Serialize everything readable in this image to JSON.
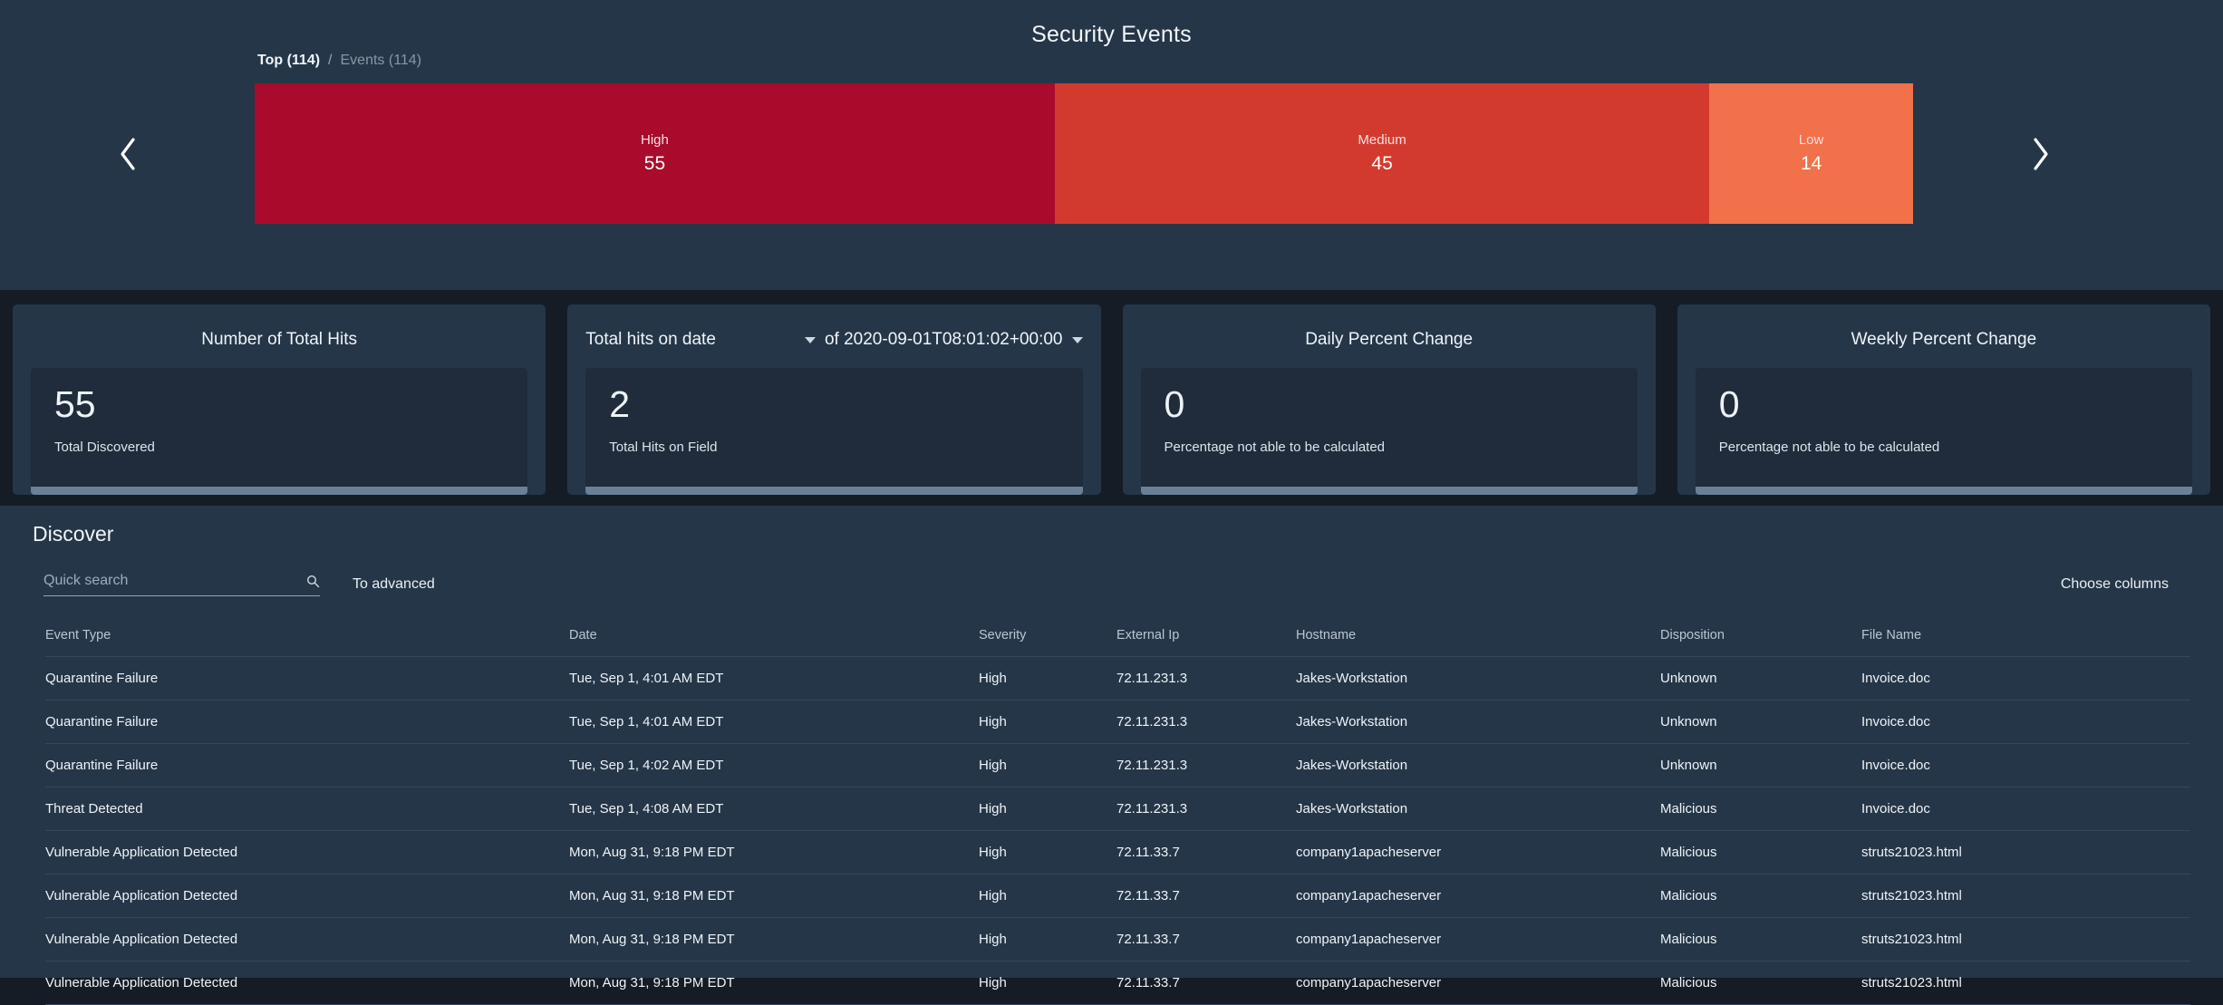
{
  "header": {
    "title": "Security Events"
  },
  "breadcrumb": {
    "active": "Top (114)",
    "separator": "/",
    "muted": "Events (114)"
  },
  "nav": {
    "prev_icon": "chevron-left-icon",
    "next_icon": "chevron-right-icon"
  },
  "severity_chart": {
    "type": "bar",
    "title": "Security Events severity distribution",
    "orientation": "horizontal-stacked",
    "total": 114,
    "categories": [
      "High",
      "Medium",
      "Low"
    ],
    "values": [
      55,
      45,
      14
    ],
    "colors": [
      "#a80b2c",
      "#d33a2e",
      "#f0714a"
    ],
    "segments": [
      {
        "label": "High",
        "value": 55,
        "color": "#a80b2c"
      },
      {
        "label": "Medium",
        "value": 45,
        "color": "#d33a2e"
      },
      {
        "label": "Low",
        "value": 14,
        "color": "#f0714a"
      }
    ]
  },
  "cards": [
    {
      "title": "Number of Total Hits",
      "value": "55",
      "subtitle": "Total Discovered",
      "has_dropdowns": false
    },
    {
      "title": "Total hits on date",
      "field_caret": "chevron-down-icon",
      "of_label": "of 2020-09-01T08:01:02+00:00",
      "date_caret": "chevron-down-icon",
      "value": "2",
      "subtitle": "Total Hits on Field",
      "has_dropdowns": true
    },
    {
      "title": "Daily Percent Change",
      "value": "0",
      "subtitle": "Percentage not able to be calculated",
      "has_dropdowns": false
    },
    {
      "title": "Weekly Percent Change",
      "value": "0",
      "subtitle": "Percentage not able to be calculated",
      "has_dropdowns": false
    }
  ],
  "discover": {
    "title": "Discover",
    "search_placeholder": "Quick search",
    "search_value": "",
    "search_icon": "search-icon",
    "to_advanced": "To advanced",
    "choose_columns": "Choose columns",
    "columns": [
      "Event Type",
      "Date",
      "Severity",
      "External Ip",
      "Hostname",
      "Disposition",
      "File Name"
    ],
    "rows": [
      {
        "event_type": "Quarantine Failure",
        "date": "Tue, Sep 1, 4:01 AM EDT",
        "severity": "High",
        "external_ip": "72.11.231.3",
        "hostname": "Jakes-Workstation",
        "disposition": "Unknown",
        "file_name": "Invoice.doc"
      },
      {
        "event_type": "Quarantine Failure",
        "date": "Tue, Sep 1, 4:01 AM EDT",
        "severity": "High",
        "external_ip": "72.11.231.3",
        "hostname": "Jakes-Workstation",
        "disposition": "Unknown",
        "file_name": "Invoice.doc"
      },
      {
        "event_type": "Quarantine Failure",
        "date": "Tue, Sep 1, 4:02 AM EDT",
        "severity": "High",
        "external_ip": "72.11.231.3",
        "hostname": "Jakes-Workstation",
        "disposition": "Unknown",
        "file_name": "Invoice.doc"
      },
      {
        "event_type": "Threat Detected",
        "date": "Tue, Sep 1, 4:08 AM EDT",
        "severity": "High",
        "external_ip": "72.11.231.3",
        "hostname": "Jakes-Workstation",
        "disposition": "Malicious",
        "file_name": "Invoice.doc"
      },
      {
        "event_type": "Vulnerable Application Detected",
        "date": "Mon, Aug 31, 9:18 PM EDT",
        "severity": "High",
        "external_ip": "72.11.33.7",
        "hostname": "company1apacheserver",
        "disposition": "Malicious",
        "file_name": "struts21023.html"
      },
      {
        "event_type": "Vulnerable Application Detected",
        "date": "Mon, Aug 31, 9:18 PM EDT",
        "severity": "High",
        "external_ip": "72.11.33.7",
        "hostname": "company1apacheserver",
        "disposition": "Malicious",
        "file_name": "struts21023.html"
      },
      {
        "event_type": "Vulnerable Application Detected",
        "date": "Mon, Aug 31, 9:18 PM EDT",
        "severity": "High",
        "external_ip": "72.11.33.7",
        "hostname": "company1apacheserver",
        "disposition": "Malicious",
        "file_name": "struts21023.html"
      },
      {
        "event_type": "Vulnerable Application Detected",
        "date": "Mon, Aug 31, 9:18 PM EDT",
        "severity": "High",
        "external_ip": "72.11.33.7",
        "hostname": "company1apacheserver",
        "disposition": "Malicious",
        "file_name": "struts21023.html"
      }
    ]
  },
  "colors": {
    "page_bg": "#151c26",
    "panel_bg": "#253648",
    "card_body_bg": "#202b3b",
    "accent_bar": "#6a8097",
    "severity_high": "#a80b2c",
    "severity_medium": "#d33a2e",
    "severity_low": "#f0714a"
  }
}
